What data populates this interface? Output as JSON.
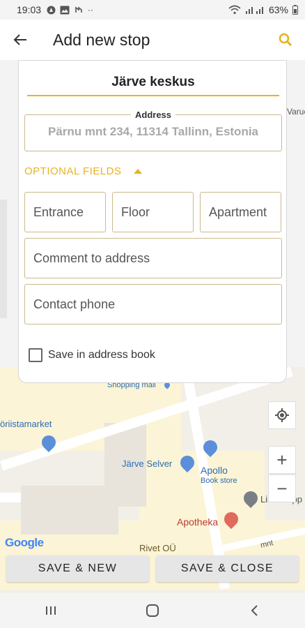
{
  "statusbar": {
    "time": "19:03",
    "battery": "63%",
    "notification_icons": [
      "notification-icon",
      "image-icon",
      "sync-icon",
      "more-dots-icon"
    ]
  },
  "appbar": {
    "title": "Add new stop",
    "back_icon": "arrow-left-icon",
    "search_icon": "search-icon",
    "accent": "#e7b31e"
  },
  "form": {
    "stop_name": "Järve keskus",
    "address_legend": "Address",
    "address_value": "Pärnu mnt 234, 11314 Tallinn, Estonia",
    "optional_label": "OPTIONAL FIELDS",
    "entrance_placeholder": "Entrance",
    "floor_placeholder": "Floor",
    "apartment_placeholder": "Apartment",
    "comment_placeholder": "Comment to address",
    "phone_placeholder": "Contact phone",
    "save_address_label": "Save in address book",
    "save_address_checked": false
  },
  "map": {
    "labels": {
      "shopping_mall": "Shopping mall",
      "toriista": "öriistamarket",
      "jarve_selver": "Järve Selver",
      "apollo": "Apollo",
      "apollo_sub": "Book store",
      "lilu": "Lilu Grupp",
      "apotheka": "Apotheka",
      "rivet": "Rivet OÜ",
      "varuc": "Varuc",
      "mnt": "mnt",
      "google": "Google"
    },
    "zoom_in": "+",
    "zoom_out": "−"
  },
  "actions": {
    "save_new": "SAVE & NEW",
    "save_close": "SAVE & CLOSE"
  }
}
